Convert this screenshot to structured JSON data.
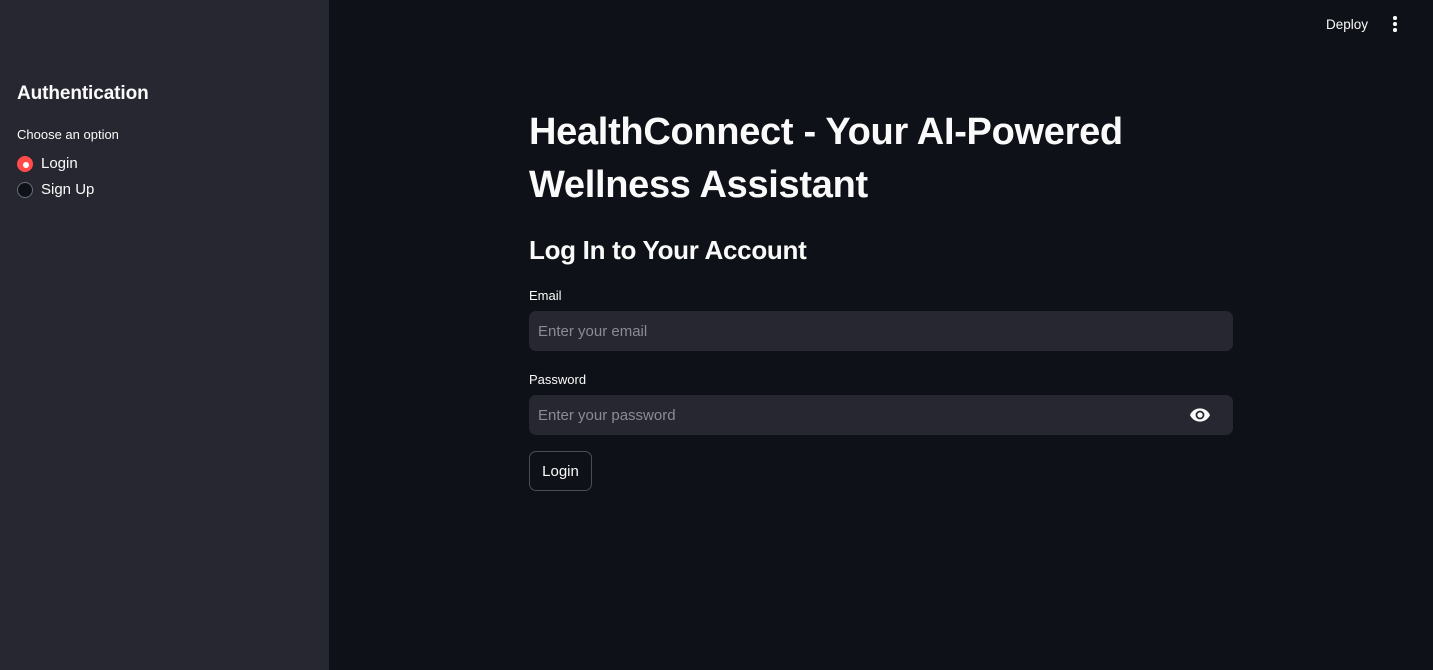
{
  "sidebar": {
    "title": "Authentication",
    "radio_label": "Choose an option",
    "options": [
      {
        "label": "Login",
        "checked": true
      },
      {
        "label": "Sign Up",
        "checked": false
      }
    ]
  },
  "header": {
    "deploy_label": "Deploy",
    "menu_icon": "more-vertical-icon"
  },
  "main": {
    "title": "HealthConnect - Your AI-Powered Wellness Assistant",
    "subheader": "Log In to Your Account",
    "email": {
      "label": "Email",
      "placeholder": "Enter your email",
      "value": ""
    },
    "password": {
      "label": "Password",
      "placeholder": "Enter your password",
      "value": "",
      "toggle_icon": "eye-icon"
    },
    "login_button": "Login"
  },
  "colors": {
    "background": "#0e1117",
    "sidebar": "#262730",
    "accent": "#ff4b4b",
    "text": "#fafafa"
  }
}
